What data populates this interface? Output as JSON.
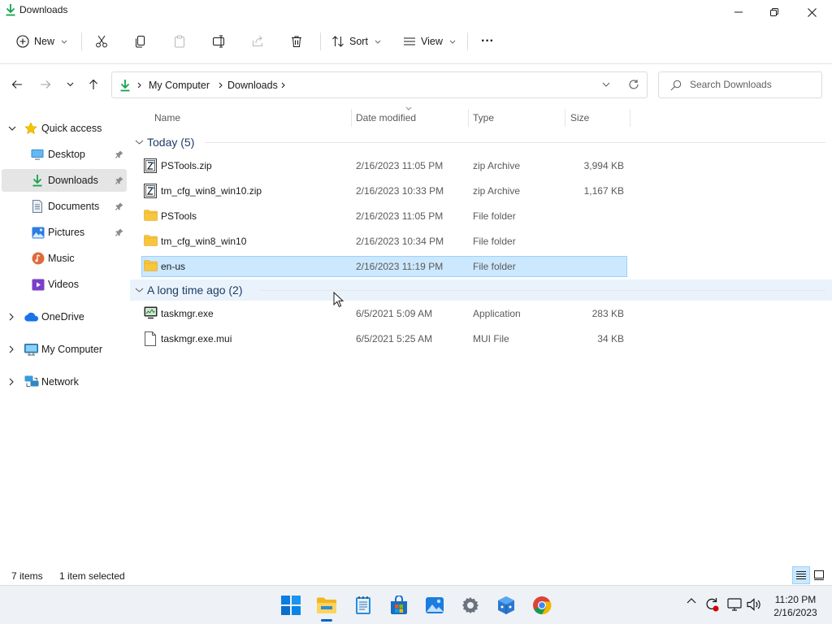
{
  "window": {
    "title": "Downloads"
  },
  "commandbar": {
    "new_label": "New",
    "sort_label": "Sort",
    "view_label": "View",
    "more_label": "···"
  },
  "address": {
    "crumbs": [
      "My Computer",
      "Downloads"
    ],
    "search_placeholder": "Search Downloads"
  },
  "navpane": {
    "quick_access": "Quick access",
    "items": [
      {
        "label": "Desktop",
        "icon": "desktop-icon"
      },
      {
        "label": "Downloads",
        "icon": "download-icon"
      },
      {
        "label": "Documents",
        "icon": "documents-icon"
      },
      {
        "label": "Pictures",
        "icon": "pictures-icon"
      },
      {
        "label": "Music",
        "icon": "music-icon"
      },
      {
        "label": "Videos",
        "icon": "videos-icon"
      }
    ],
    "onedrive": "OneDrive",
    "my_computer": "My Computer",
    "network": "Network"
  },
  "columns": {
    "name": "Name",
    "date": "Date modified",
    "type": "Type",
    "size": "Size"
  },
  "groups": [
    {
      "label": "Today (5)",
      "rows": [
        {
          "name": "PSTools.zip",
          "date": "2/16/2023 11:05 PM",
          "type": "zip Archive",
          "size": "3,994 KB",
          "icon": "zip-icon"
        },
        {
          "name": "tm_cfg_win8_win10.zip",
          "date": "2/16/2023 10:33 PM",
          "type": "zip Archive",
          "size": "1,167 KB",
          "icon": "zip-icon"
        },
        {
          "name": "PSTools",
          "date": "2/16/2023 11:05 PM",
          "type": "File folder",
          "size": "",
          "icon": "folder-icon"
        },
        {
          "name": "tm_cfg_win8_win10",
          "date": "2/16/2023 10:34 PM",
          "type": "File folder",
          "size": "",
          "icon": "folder-icon"
        },
        {
          "name": "en-us",
          "date": "2/16/2023 11:19 PM",
          "type": "File folder",
          "size": "",
          "icon": "folder-icon",
          "selected": true
        }
      ]
    },
    {
      "label": "A long time ago (2)",
      "rows": [
        {
          "name": "taskmgr.exe",
          "date": "6/5/2021 5:09 AM",
          "type": "Application",
          "size": "283 KB",
          "icon": "exe-icon"
        },
        {
          "name": "taskmgr.exe.mui",
          "date": "6/5/2021 5:25 AM",
          "type": "MUI File",
          "size": "34 KB",
          "icon": "file-icon"
        }
      ]
    }
  ],
  "status": {
    "items": "7 items",
    "selected": "1 item selected"
  },
  "taskbar": {
    "time": "11:20 PM",
    "date": "2/16/2023"
  },
  "colors": {
    "accent": "#0067c0",
    "selection": "#cce8ff",
    "folder": "#f8c63d"
  }
}
